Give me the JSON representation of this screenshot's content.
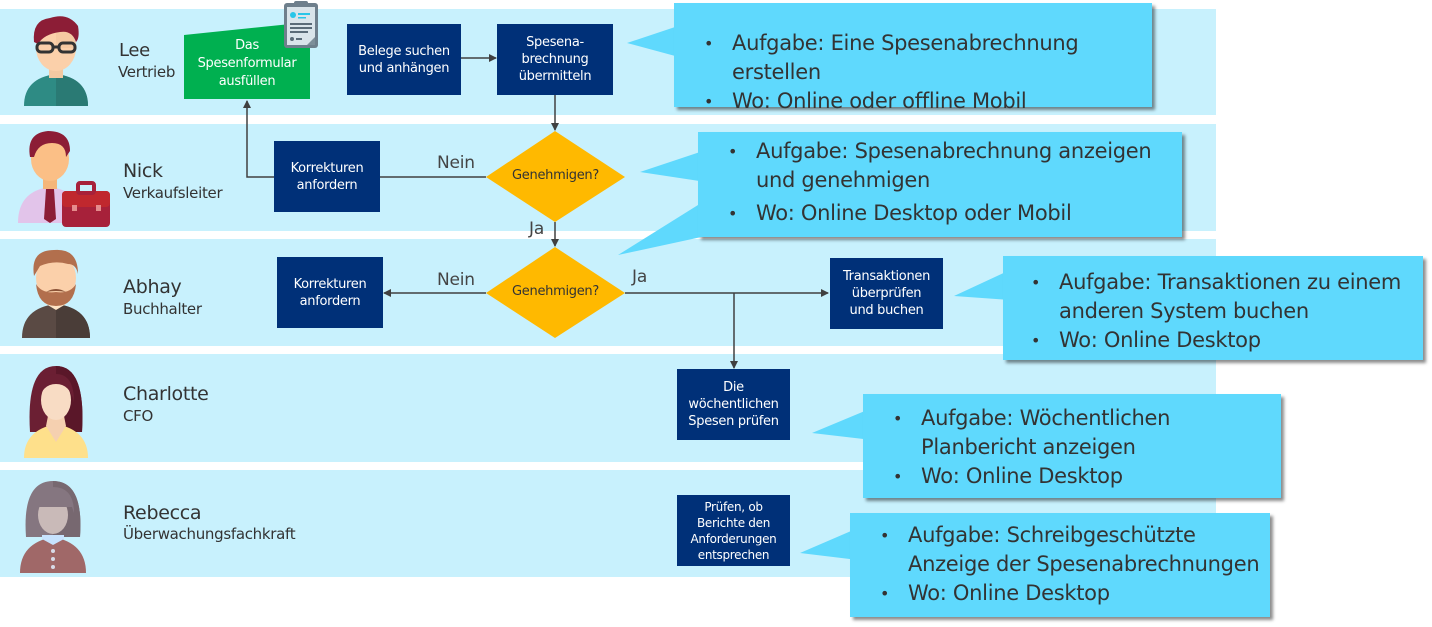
{
  "colors": {
    "lane": "#c8f1fd",
    "process_box": "#003078",
    "start_box": "#00b050",
    "decision": "#ffb900",
    "callout": "#5fd9fd",
    "connector": "#404040"
  },
  "lanes": [
    {
      "person": "Lee",
      "role": "Vertrieb",
      "avatar": "man-glasses-avatar-icon"
    },
    {
      "person": "Nick",
      "role": "Verkaufsleiter",
      "avatar": "manager-briefcase-avatar-icon"
    },
    {
      "person": "Abhay",
      "role": "Buchhalter",
      "avatar": "bearded-man-avatar-icon"
    },
    {
      "person": "Charlotte",
      "role": "CFO",
      "avatar": "woman-long-hair-avatar-icon"
    },
    {
      "person": "Rebecca",
      "role": "Überwachungsfachkraft",
      "avatar": "woman-bob-hair-avatar-icon"
    }
  ],
  "steps": {
    "fill_form": {
      "lines": [
        "Das",
        "Spesenformular",
        "ausfüllen"
      ],
      "icon": "clipboard-form-icon"
    },
    "find_receipts": {
      "lines": [
        "Belege suchen",
        "und anhängen"
      ]
    },
    "submit_report": {
      "lines": [
        "Spesena-",
        "brechnung",
        "übermitteln"
      ]
    },
    "request_corrections_nick": {
      "lines": [
        "Korrekturen",
        "anfordern"
      ]
    },
    "approve_nick": {
      "label": "Genehmigen?"
    },
    "request_corrections_abhay": {
      "lines": [
        "Korrekturen",
        "anfordern"
      ]
    },
    "approve_abhay": {
      "label": "Genehmigen?"
    },
    "post_transactions": {
      "lines": [
        "Transaktionen",
        "überprüfen",
        "und buchen"
      ]
    },
    "weekly_review": {
      "lines": [
        "Die",
        "wöchentlichen",
        "Spesen prüfen"
      ]
    },
    "compliance_check": {
      "lines": [
        "Prüfen, ob",
        "Berichte den",
        "Anforderungen",
        "entsprechen"
      ]
    }
  },
  "edge_labels": {
    "nick_no": "Nein",
    "nick_yes": "Ja",
    "abhay_no": "Nein",
    "abhay_yes": "Ja"
  },
  "callouts": [
    {
      "items": [
        "Aufgabe: Eine Spesenabrechnung erstellen",
        "Wo: Online oder offline Mobil"
      ]
    },
    {
      "items": [
        "Aufgabe: Spesenabrechnung anzeigen und genehmigen",
        "Wo: Online Desktop oder Mobil"
      ]
    },
    {
      "items": [
        "Aufgabe: Transaktionen zu einem anderen System buchen",
        "Wo: Online Desktop"
      ]
    },
    {
      "items": [
        "Aufgabe: Wöchentlichen Planbericht anzeigen",
        "Wo: Online Desktop"
      ]
    },
    {
      "items": [
        "Aufgabe: Schreibgeschützte Anzeige der Spesenabrechnungen",
        "Wo: Online Desktop"
      ]
    }
  ]
}
